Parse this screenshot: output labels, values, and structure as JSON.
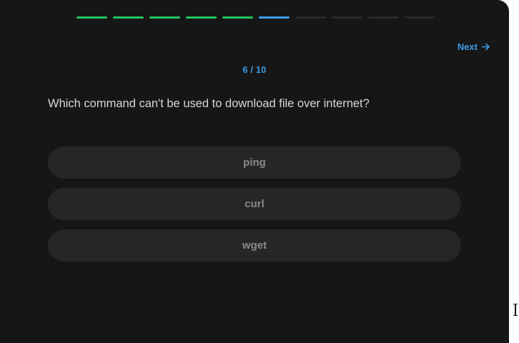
{
  "progress": {
    "current": 6,
    "total": 10,
    "completed_color": "#22c55e",
    "current_color": "#3b9dea",
    "pending_color": "#2a2a2a"
  },
  "nav": {
    "next_label": "Next",
    "next_icon": "arrow-right-icon",
    "accent_color": "#3b9dea"
  },
  "counter": {
    "text": "6 / 10"
  },
  "question": {
    "text": "Which command can't be used to download file over internet?"
  },
  "options": [
    {
      "label": "ping"
    },
    {
      "label": "curl"
    },
    {
      "label": "wget"
    }
  ]
}
